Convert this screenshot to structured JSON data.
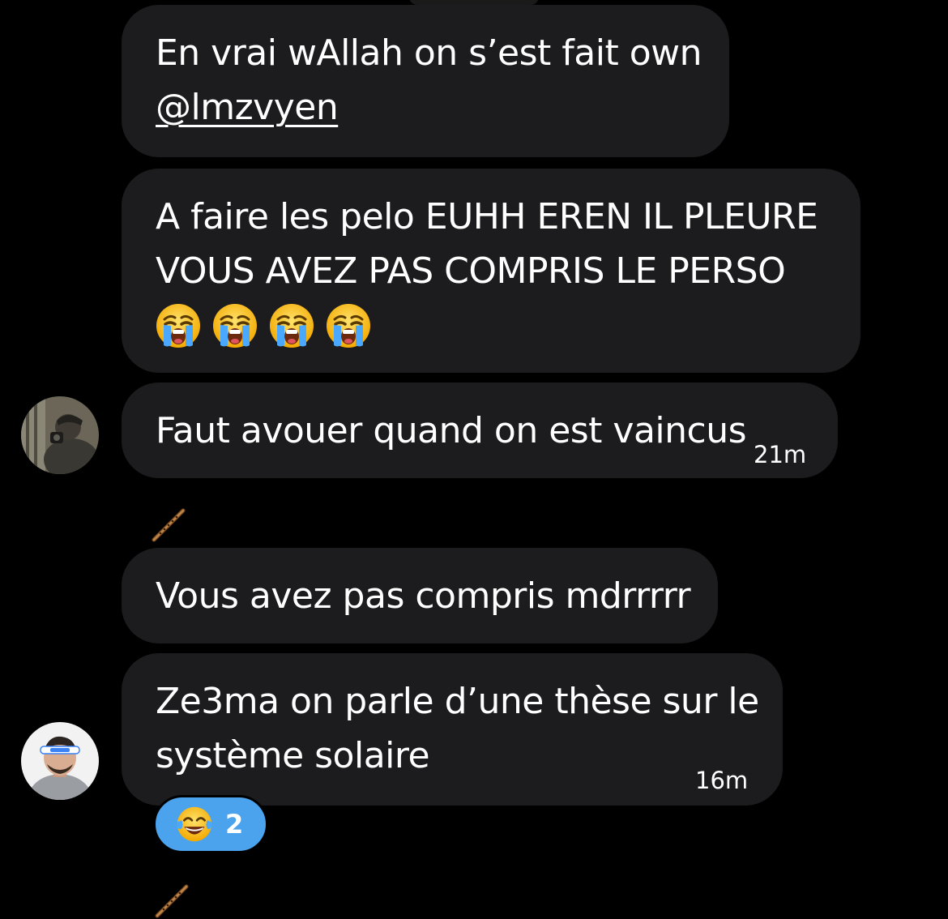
{
  "messages": [
    {
      "id": "m1",
      "lines": [
        "En vrai wAllah on s’est fait own"
      ],
      "mention": "@lmzvyen"
    },
    {
      "id": "m2",
      "lines": [
        "A faire les pelo EUHH EREN IL PLEURE",
        "VOUS AVEZ PAS COMPRIS LE PERSO"
      ],
      "emoji": [
        "loudly-crying-face",
        "loudly-crying-face",
        "loudly-crying-face",
        "loudly-crying-face"
      ]
    },
    {
      "id": "m3",
      "lines": [
        "Faut avouer quand on est vaincus"
      ],
      "timestamp": "21m"
    },
    {
      "id": "m4",
      "lines": [
        "Vous avez pas compris mdrrrrr"
      ]
    },
    {
      "id": "m5",
      "lines": [
        "Ze3ma on parle d’une thèse sur le",
        "système solaire"
      ],
      "timestamp": "16m",
      "reaction": {
        "emoji": "face-with-tears-of-joy",
        "count": "2"
      }
    }
  ],
  "decorations": [
    "flute-icon",
    "flute-icon"
  ],
  "colors": {
    "background": "#000000",
    "bubble": "#1c1c1e",
    "text": "#ffffff",
    "reaction": "#4aa3ec"
  }
}
